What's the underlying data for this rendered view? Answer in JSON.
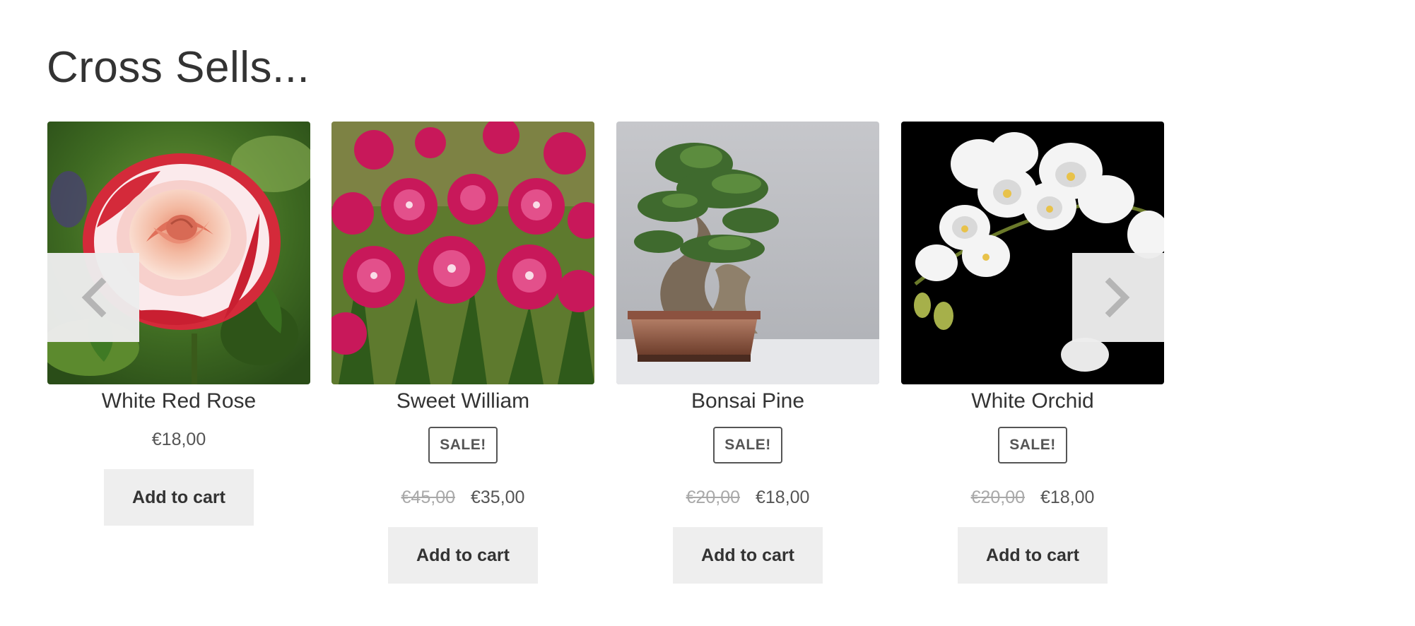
{
  "section": {
    "title": "Cross Sells..."
  },
  "products": [
    {
      "name": "White Red Rose",
      "price": "€18,00",
      "on_sale": false,
      "button_label": "Add to cart",
      "image": "white-red-rose-photo"
    },
    {
      "name": "Sweet William",
      "sale_badge": "SALE!",
      "old_price": "€45,00",
      "price": "€35,00",
      "on_sale": true,
      "button_label": "Add to cart",
      "image": "sweet-william-photo"
    },
    {
      "name": "Bonsai Pine",
      "sale_badge": "SALE!",
      "old_price": "€20,00",
      "price": "€18,00",
      "on_sale": true,
      "button_label": "Add to cart",
      "image": "bonsai-pine-photo"
    },
    {
      "name": "White Orchid",
      "sale_badge": "SALE!",
      "old_price": "€20,00",
      "price": "€18,00",
      "on_sale": true,
      "button_label": "Add to cart",
      "image": "white-orchid-photo"
    }
  ],
  "navigation": {
    "prev_icon": "chevron-left-icon",
    "next_icon": "chevron-right-icon"
  },
  "colors": {
    "text": "#333333",
    "button_bg": "#eeeeee",
    "strikethrough_price": "#a9a9a9",
    "badge_border": "#555555"
  }
}
